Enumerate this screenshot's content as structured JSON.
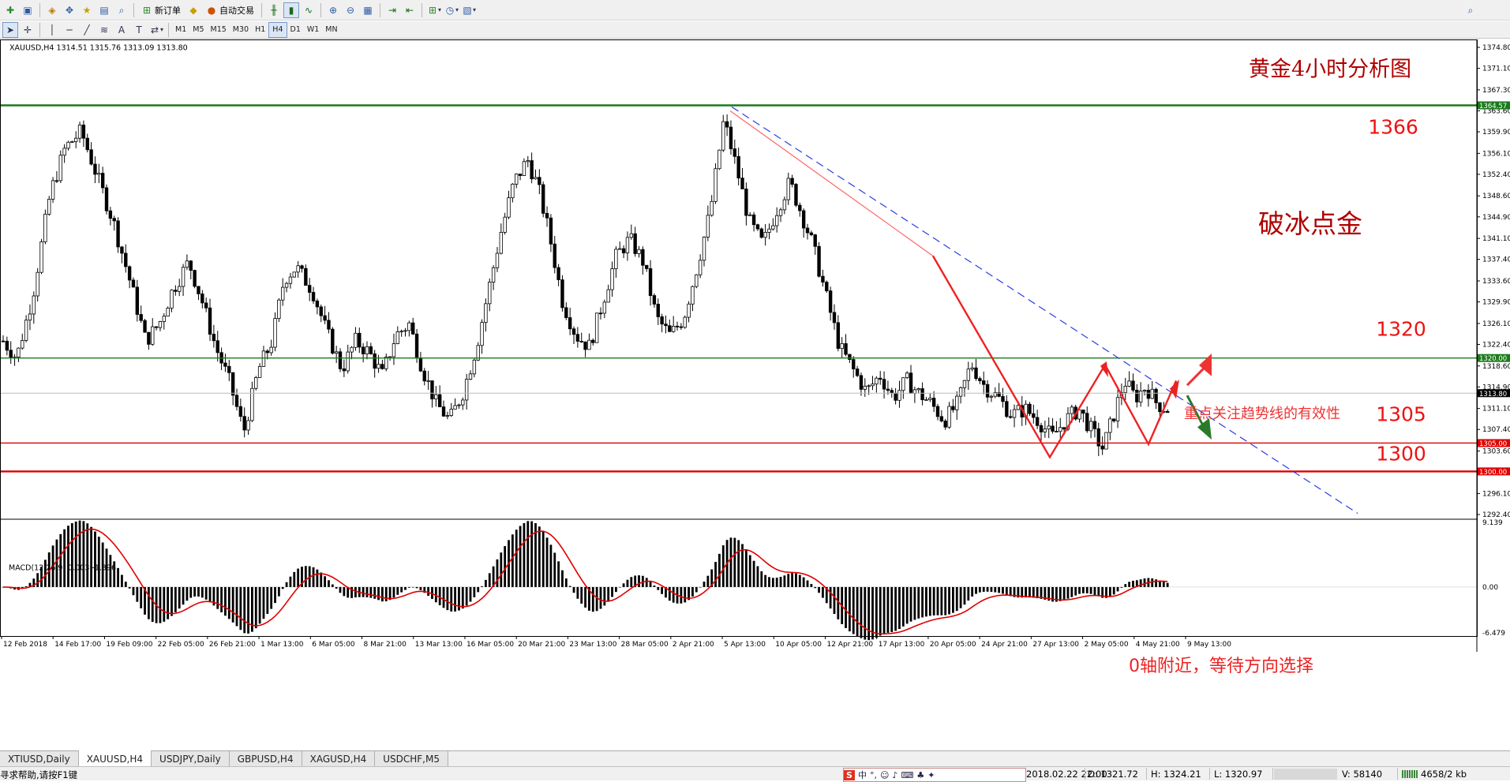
{
  "toolbar": {
    "new_order_label": "新订单",
    "auto_trade_label": "自动交易",
    "timeframes": [
      "M1",
      "M5",
      "M15",
      "M30",
      "H1",
      "H4",
      "D1",
      "W1",
      "MN"
    ],
    "active_timeframe": "H4"
  },
  "chart": {
    "symbol_header": "XAUUSD,H4  1314.51 1315.76 1313.09 1313.80",
    "title": "黄金4小时分析图",
    "watermark": "破冰点金",
    "note_trendline": "重点关注趋势线的有效性",
    "note_macd": "0轴附近，等待方向选择",
    "levels": [
      {
        "value": 1364.57,
        "label": "1366",
        "color": "#1a7a1a"
      },
      {
        "value": 1320.0,
        "label": "1320",
        "color": "#1a7a1a"
      },
      {
        "value": 1305.0,
        "label": "1305",
        "color": "#e00000"
      },
      {
        "value": 1300.0,
        "label": "1300",
        "color": "#e00000"
      }
    ],
    "level_tags": [
      "1364.57",
      "1320.00",
      "1305.00",
      "1300.00"
    ],
    "current_price": "1313.80",
    "colors": {
      "up": "#1a7a1a",
      "down": "#e00000",
      "accent": "#ee2222",
      "bg": "#ffffff",
      "candle": "#000000",
      "trend": "#2a3fe0"
    }
  },
  "chart_data": {
    "type": "candlestick",
    "ylim": [
      1292.4,
      1374.8
    ],
    "y_ticks": [
      "1374.80",
      "1371.10",
      "1367.30",
      "1363.60",
      "1359.90",
      "1356.10",
      "1352.40",
      "1348.60",
      "1344.90",
      "1341.10",
      "1337.40",
      "1333.60",
      "1329.90",
      "1326.10",
      "1322.40",
      "1318.60",
      "1314.90",
      "1311.10",
      "1307.40",
      "1303.60",
      "1296.10",
      "1292.40"
    ],
    "x_labels": [
      "12 Feb 2018",
      "14 Feb 17:00",
      "19 Feb 09:00",
      "22 Feb 05:00",
      "26 Feb 21:00",
      "1 Mar 13:00",
      "6 Mar 05:00",
      "8 Mar 21:00",
      "13 Mar 13:00",
      "16 Mar 05:00",
      "20 Mar 21:00",
      "23 Mar 13:00",
      "28 Mar 05:00",
      "2 Apr 21:00",
      "5 Apr 13:00",
      "10 Apr 05:00",
      "12 Apr 21:00",
      "17 Apr 13:00",
      "20 Apr 05:00",
      "24 Apr 21:00",
      "27 Apr 13:00",
      "2 May 05:00",
      "4 May 21:00",
      "9 May 13:00"
    ],
    "close_path": [
      [
        0,
        1323
      ],
      [
        10,
        1320
      ],
      [
        22,
        1331
      ],
      [
        35,
        1349
      ],
      [
        46,
        1357
      ],
      [
        58,
        1360
      ],
      [
        70,
        1352
      ],
      [
        82,
        1344
      ],
      [
        95,
        1333
      ],
      [
        106,
        1323
      ],
      [
        116,
        1326
      ],
      [
        126,
        1332
      ],
      [
        138,
        1337
      ],
      [
        148,
        1330
      ],
      [
        158,
        1322
      ],
      [
        168,
        1316
      ],
      [
        179,
        1307
      ],
      [
        190,
        1318
      ],
      [
        200,
        1323
      ],
      [
        209,
        1334
      ],
      [
        218,
        1336
      ],
      [
        230,
        1332
      ],
      [
        240,
        1325
      ],
      [
        252,
        1318
      ],
      [
        262,
        1323
      ],
      [
        272,
        1321
      ],
      [
        282,
        1317
      ],
      [
        292,
        1324
      ],
      [
        302,
        1326
      ],
      [
        312,
        1318
      ],
      [
        322,
        1312
      ],
      [
        332,
        1309
      ],
      [
        342,
        1314
      ],
      [
        352,
        1322
      ],
      [
        361,
        1332
      ],
      [
        370,
        1342
      ],
      [
        380,
        1351
      ],
      [
        390,
        1355
      ],
      [
        398,
        1350
      ],
      [
        406,
        1342
      ],
      [
        416,
        1330
      ],
      [
        426,
        1324
      ],
      [
        436,
        1322
      ],
      [
        446,
        1330
      ],
      [
        456,
        1338
      ],
      [
        466,
        1341
      ],
      [
        476,
        1337
      ],
      [
        486,
        1327
      ],
      [
        496,
        1324
      ],
      [
        506,
        1327
      ],
      [
        516,
        1336
      ],
      [
        526,
        1346
      ],
      [
        536,
        1362
      ],
      [
        545,
        1354
      ],
      [
        555,
        1344
      ],
      [
        565,
        1340
      ],
      [
        575,
        1346
      ],
      [
        585,
        1351
      ],
      [
        593,
        1346
      ],
      [
        602,
        1340
      ],
      [
        612,
        1331
      ],
      [
        622,
        1322
      ],
      [
        632,
        1318
      ],
      [
        642,
        1314
      ],
      [
        652,
        1317
      ],
      [
        662,
        1313
      ],
      [
        672,
        1316
      ],
      [
        680,
        1314
      ],
      [
        690,
        1312
      ],
      [
        700,
        1309
      ],
      [
        710,
        1312
      ],
      [
        720,
        1319
      ],
      [
        730,
        1315
      ],
      [
        740,
        1313
      ],
      [
        750,
        1310
      ],
      [
        760,
        1311
      ],
      [
        770,
        1309
      ],
      [
        780,
        1306
      ],
      [
        790,
        1309
      ],
      [
        800,
        1311
      ],
      [
        810,
        1307
      ],
      [
        818,
        1304
      ],
      [
        826,
        1310
      ],
      [
        834,
        1316
      ],
      [
        842,
        1313
      ],
      [
        850,
        1315
      ],
      [
        858,
        1312
      ],
      [
        866,
        1311
      ]
    ],
    "ma": {
      "close_index": 866
    },
    "macd": {
      "name": "MACD(12,26,9) 0.003 -1.396",
      "y_ticks": [
        "9.139",
        "0.00",
        "-6.479"
      ],
      "ylim": [
        -6.479,
        9.139
      ]
    }
  },
  "tabs": [
    "XTIUSD,Daily",
    "XAUUSD,H4",
    "USDJPY,Daily",
    "GBPUSD,H4",
    "XAGUSD,H4",
    "USDCHF,M5"
  ],
  "active_tab": "XAUUSD,H4",
  "status": {
    "help": "寻求帮助,请按F1键",
    "date": "2018.02.22 22:00",
    "open": "O: 1321.72",
    "high": "H: 1324.21",
    "low": "L: 1320.97",
    "volume": "V: 58140",
    "traffic": "4658/2 kb"
  }
}
